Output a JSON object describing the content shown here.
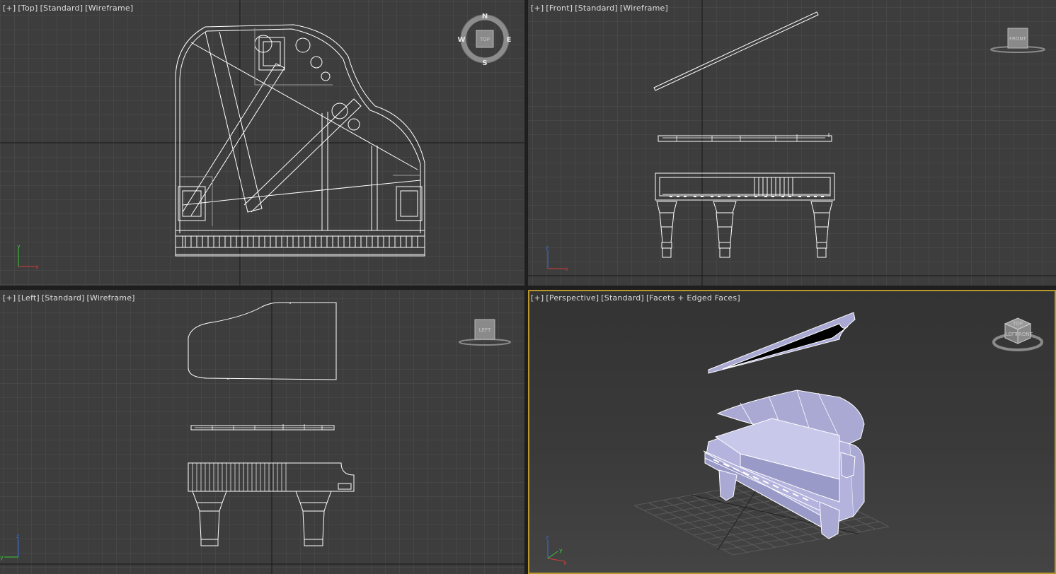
{
  "viewports": {
    "top": {
      "menu": "[+]",
      "view": "[Top]",
      "shading_mode": "[Standard]",
      "display": "[Wireframe]"
    },
    "front": {
      "menu": "[+]",
      "view": "[Front]",
      "shading_mode": "[Standard]",
      "display": "[Wireframe]"
    },
    "left": {
      "menu": "[+]",
      "view": "[Left]",
      "shading_mode": "[Standard]",
      "display": "[Wireframe]"
    },
    "perspective": {
      "menu": "[+]",
      "view": "[Perspective]",
      "shading_mode": "[Standard]",
      "display": "[Facets + Edged Faces]",
      "active": true
    }
  },
  "viewcube": {
    "compass": {
      "north": "N",
      "south": "S",
      "east": "E",
      "west": "W"
    },
    "top_face": "TOP",
    "front_face": "FRONT",
    "left_face": "LEFT",
    "persp_faces": [
      "TOP",
      "LEFT",
      "FRONT"
    ]
  },
  "axes": {
    "x": "x",
    "y": "y",
    "z": "z"
  },
  "colors": {
    "viewport_bg": "#3d3d3d",
    "grid": "#4e4e4e",
    "grid_major": "#1a1a1a",
    "wireframe": "#ffffff",
    "active_border": "#b8982e",
    "piano_facet": "#a9a9d4",
    "axis_x": "#d23c3c",
    "axis_y": "#3cc83c",
    "axis_z": "#3c6ed2"
  }
}
